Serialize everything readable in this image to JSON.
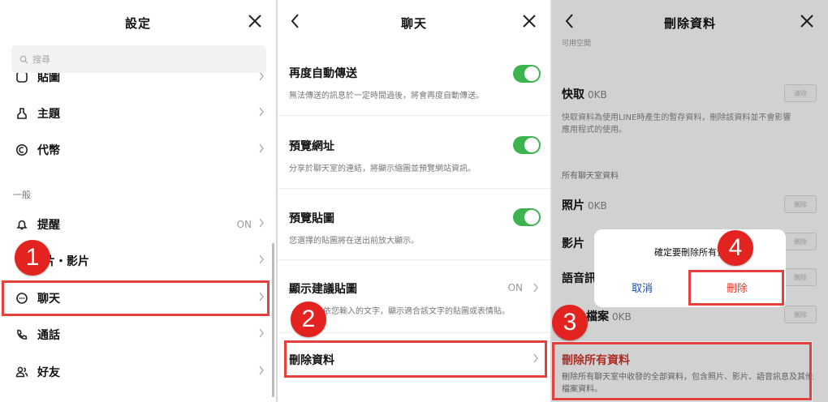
{
  "settings": {
    "title": "設定",
    "search_placeholder": "搜尋",
    "top_partial": "貼圖",
    "items": [
      {
        "label": "主題"
      },
      {
        "label": "代幣"
      }
    ],
    "section_general": "一般",
    "general_items": [
      {
        "label": "提醒",
        "value": "ON"
      },
      {
        "label": "片・影片"
      },
      {
        "label": "聊天"
      },
      {
        "label": "通話"
      },
      {
        "label": "好友"
      }
    ]
  },
  "chat": {
    "title": "聊天",
    "options": [
      {
        "title": "再度自動傳送",
        "desc": "無法傳送的訊息於一定時間過後，將會再度自動傳送。",
        "toggle": true
      },
      {
        "title": "預覽網址",
        "desc": "分享於聊天室的連結，將顯示縮圖並預覽網站資訊。",
        "toggle": true
      },
      {
        "title": "預覽貼圖",
        "desc": "您選擇的貼圖將在送出前放大顯示。",
        "toggle": true
      },
      {
        "title": "顯示建議貼圖",
        "desc": "依您輸入的文字，顯示適合該文字的貼圖或表情貼。",
        "value": "ON"
      }
    ],
    "delete_data": "刪除資料"
  },
  "delete": {
    "title": "刪除資料",
    "top_partial": "可用空間",
    "cache_title": "快取",
    "cache_size": "0KB",
    "cache_desc": "快取資料為使用LINE時產生的暫存資料，刪除該資料並不會影響應用程式的使用。",
    "clear_label": "清除",
    "section_all": "所有聊天室資料",
    "photos_title": "照片",
    "photos_size": "0KB",
    "videos_title": "影片",
    "voice_title": "語音訊",
    "files_title": "檔案",
    "files_size": "0KB",
    "delete_small": "刪除",
    "delete_all_title": "刪除所有資料",
    "delete_all_desc": "刪除所有聊天室中收發的全部資料，包含照片、影片、語音訊息及其他檔案資料。",
    "dialog": {
      "message": "確定要刪除所有資",
      "cancel": "取消",
      "confirm": "刪除"
    }
  },
  "steps": [
    "1",
    "2",
    "3",
    "4"
  ],
  "colors": {
    "highlight": "#e34040",
    "badge": "#e3231f",
    "toggle_on": "#3cb550",
    "link_blue": "#1a4fa8",
    "danger": "#e03a2e"
  }
}
